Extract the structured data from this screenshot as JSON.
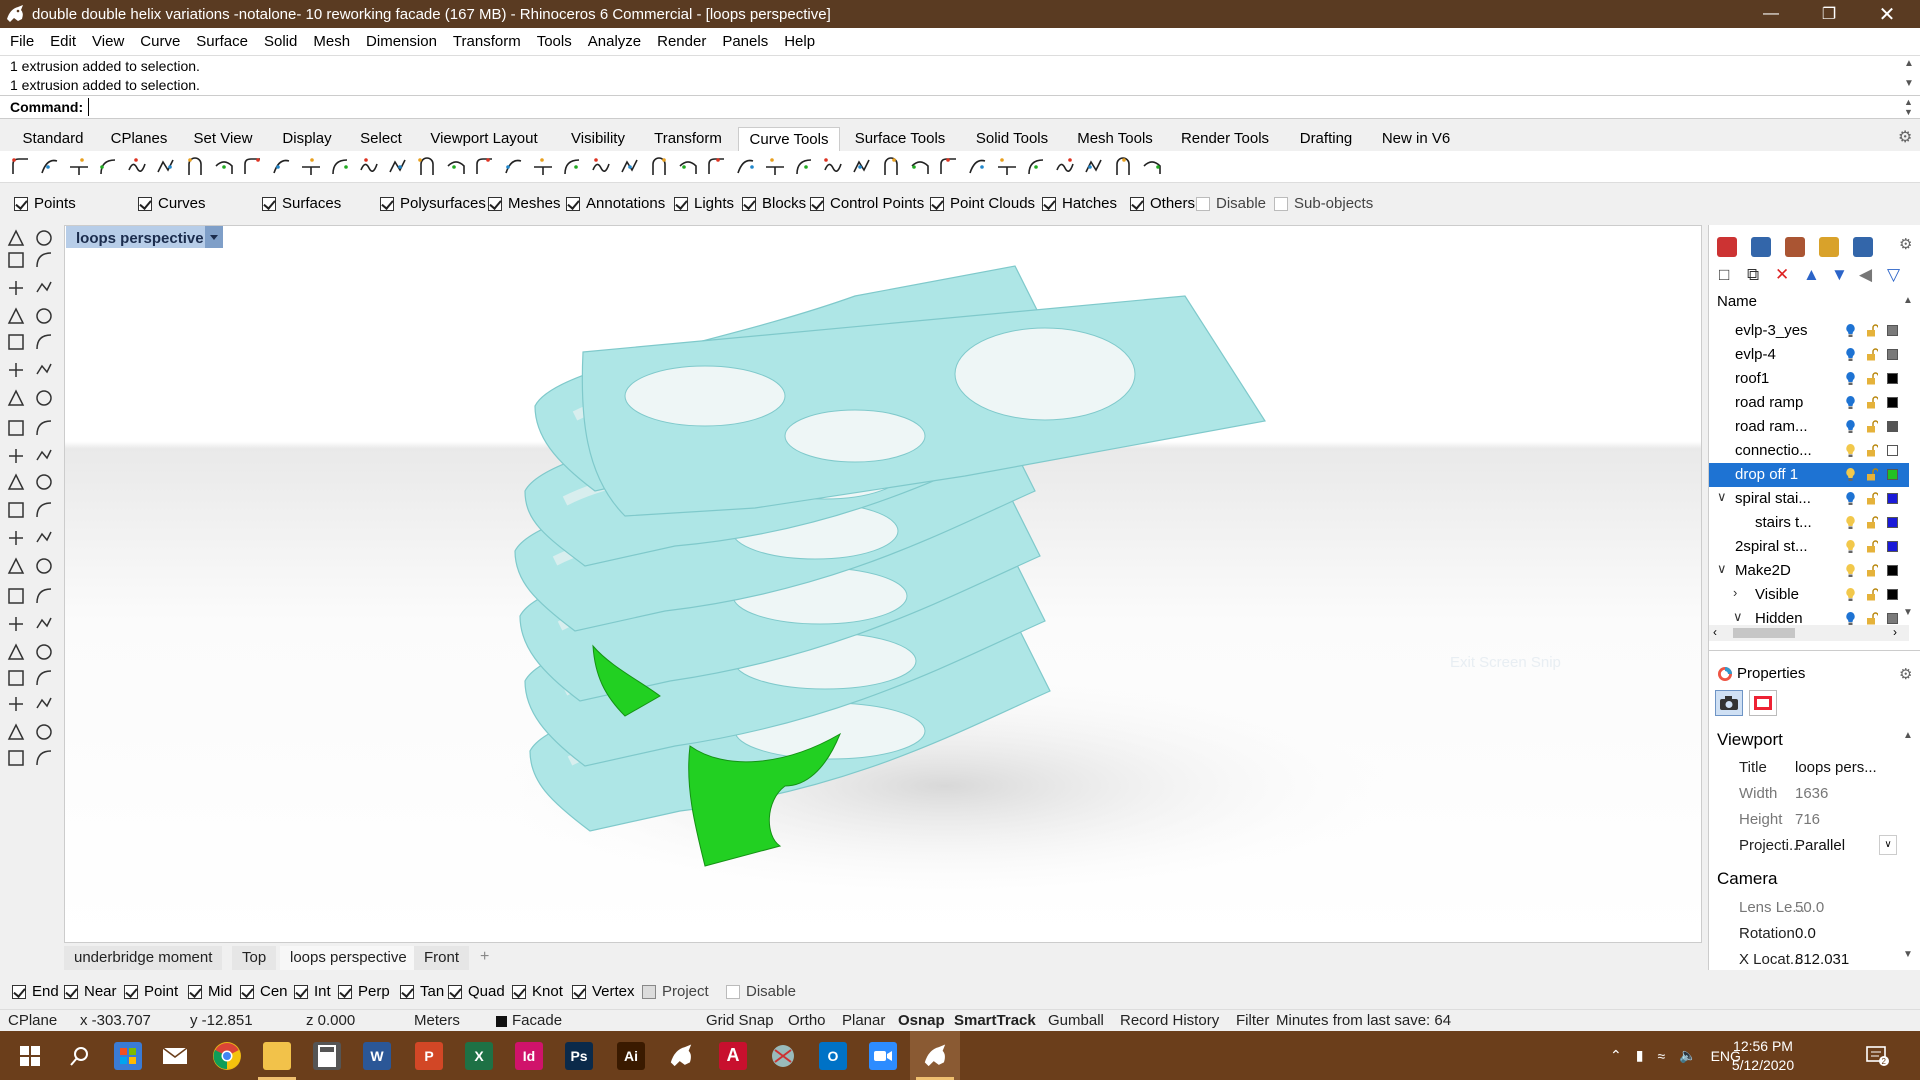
{
  "window": {
    "title": "double double helix variations -notalone- 10 reworking facade (167 MB) - Rhinoceros 6 Commercial - [loops perspective]",
    "controls": [
      "minimize",
      "restore",
      "close"
    ]
  },
  "menu": [
    "File",
    "Edit",
    "View",
    "Curve",
    "Surface",
    "Solid",
    "Mesh",
    "Dimension",
    "Transform",
    "Tools",
    "Analyze",
    "Render",
    "Panels",
    "Help"
  ],
  "command": {
    "history": [
      "1 extrusion added to selection.",
      "1 extrusion added to selection."
    ],
    "label": "Command:",
    "value": ""
  },
  "toolbar_tabs": [
    "Standard",
    "CPlanes",
    "Set View",
    "Display",
    "Select",
    "Viewport Layout",
    "Visibility",
    "Transform",
    "Curve Tools",
    "Surface Tools",
    "Solid Tools",
    "Mesh Tools",
    "Render Tools",
    "Drafting",
    "New in V6"
  ],
  "active_toolbar_tab": "Curve Tools",
  "selection_filter": [
    {
      "label": "Points",
      "checked": true
    },
    {
      "label": "Curves",
      "checked": true
    },
    {
      "label": "Surfaces",
      "checked": true
    },
    {
      "label": "Polysurfaces",
      "checked": true
    },
    {
      "label": "Meshes",
      "checked": true
    },
    {
      "label": "Annotations",
      "checked": true
    },
    {
      "label": "Lights",
      "checked": true
    },
    {
      "label": "Blocks",
      "checked": true
    },
    {
      "label": "Control Points",
      "checked": true
    },
    {
      "label": "Point Clouds",
      "checked": true
    },
    {
      "label": "Hatches",
      "checked": true
    },
    {
      "label": "Others",
      "checked": true
    },
    {
      "label": "Disable",
      "checked": false
    },
    {
      "label": "Sub-objects",
      "checked": false
    }
  ],
  "viewport": {
    "title": "loops perspective",
    "watermark": "Exit Screen Snip",
    "colors": {
      "model": "#aee6e6",
      "model_edge": "#7fc9cb",
      "highlight": "#22d022"
    }
  },
  "viewport_tabs": [
    "underbridge moment",
    "Top",
    "loops perspective",
    "Front"
  ],
  "active_viewport_tab": "loops perspective",
  "osnap": [
    {
      "label": "End",
      "checked": true
    },
    {
      "label": "Near",
      "checked": true
    },
    {
      "label": "Point",
      "checked": true
    },
    {
      "label": "Mid",
      "checked": true
    },
    {
      "label": "Cen",
      "checked": true
    },
    {
      "label": "Int",
      "checked": true
    },
    {
      "label": "Perp",
      "checked": true
    },
    {
      "label": "Tan",
      "checked": true
    },
    {
      "label": "Quad",
      "checked": true
    },
    {
      "label": "Knot",
      "checked": true
    },
    {
      "label": "Vertex",
      "checked": true
    },
    {
      "label": "Project",
      "checked": false
    },
    {
      "label": "Disable",
      "checked": false
    }
  ],
  "status": {
    "cplane": "CPlane",
    "x": "x -303.707",
    "y": "y -12.851",
    "z": "z 0.000",
    "units": "Meters",
    "layer": "Facade",
    "grid_snap": "Grid Snap",
    "ortho": "Ortho",
    "planar": "Planar",
    "osnap": "Osnap",
    "smarttrack": "SmartTrack",
    "gumball": "Gumball",
    "record_history": "Record History",
    "filter": "Filter",
    "minutes": "Minutes from last save: 64"
  },
  "layers": {
    "header": "Name",
    "items": [
      {
        "name": "evlp-3_yes",
        "indent": 1,
        "bulb": "#1e73d3",
        "swatch": "#7a7a7a"
      },
      {
        "name": "evlp-4",
        "indent": 1,
        "bulb": "#1e73d3",
        "swatch": "#7a7a7a"
      },
      {
        "name": "roof1",
        "indent": 1,
        "bulb": "#1e73d3",
        "swatch": "#000000"
      },
      {
        "name": "road ramp",
        "indent": 1,
        "bulb": "#1e73d3",
        "swatch": "#000000"
      },
      {
        "name": "road ram...",
        "indent": 1,
        "bulb": "#1e73d3",
        "swatch": "#555555"
      },
      {
        "name": "connectio...",
        "indent": 1,
        "bulb": "#f2c84b",
        "swatch": "#ffffff"
      },
      {
        "name": "drop off 1",
        "indent": 1,
        "bulb": "#f2c84b",
        "swatch": "#22c022",
        "selected": true
      },
      {
        "name": "spiral stai...",
        "indent": 1,
        "bulb": "#1e73d3",
        "swatch": "#1a1ad8",
        "expander": "v"
      },
      {
        "name": "stairs t...",
        "indent": 2,
        "bulb": "#f2c84b",
        "swatch": "#1a1ad8"
      },
      {
        "name": "2spiral st...",
        "indent": 1,
        "bulb": "#f2c84b",
        "swatch": "#1a1ad8"
      },
      {
        "name": "Make2D",
        "indent": 1,
        "bulb": "#f2c84b",
        "swatch": "#000000",
        "expander": "v"
      },
      {
        "name": "Visible",
        "indent": 2,
        "bulb": "#f2c84b",
        "swatch": "#000000",
        "expander": ">"
      },
      {
        "name": "Hidden",
        "indent": 2,
        "bulb": "#1e73d3",
        "swatch": "#7a7a7a",
        "expander": "v"
      }
    ]
  },
  "properties": {
    "title": "Properties",
    "viewport_section": "Viewport",
    "camera_section": "Camera",
    "rows": [
      {
        "key": "Title",
        "value": "loops pers...",
        "disabled": false
      },
      {
        "key": "Width",
        "value": "1636",
        "disabled": true
      },
      {
        "key": "Height",
        "value": "716",
        "disabled": true
      },
      {
        "key": "Projecti...",
        "value": "Parallel",
        "disabled": false
      }
    ],
    "camera_rows": [
      {
        "key": "Lens Le...",
        "value": "50.0",
        "disabled": true
      },
      {
        "key": "Rotation",
        "value": "0.0",
        "disabled": false
      },
      {
        "key": "X Locat...",
        "value": "812.031",
        "disabled": false
      }
    ]
  },
  "taskbar": {
    "apps": [
      {
        "name": "start",
        "label": ""
      },
      {
        "name": "search",
        "label": ""
      },
      {
        "name": "store",
        "label": ""
      },
      {
        "name": "mail",
        "label": ""
      },
      {
        "name": "chrome",
        "label": ""
      },
      {
        "name": "file-explorer",
        "label": ""
      },
      {
        "name": "calculator",
        "label": ""
      },
      {
        "name": "word",
        "label": "W"
      },
      {
        "name": "powerpoint",
        "label": "P"
      },
      {
        "name": "excel",
        "label": "X"
      },
      {
        "name": "indesign",
        "label": "Id"
      },
      {
        "name": "photoshop",
        "label": "Ps"
      },
      {
        "name": "illustrator",
        "label": "Ai"
      },
      {
        "name": "rhino5",
        "label": ""
      },
      {
        "name": "acrobat",
        "label": ""
      },
      {
        "name": "snipping",
        "label": ""
      },
      {
        "name": "outlook",
        "label": "O"
      },
      {
        "name": "zoom",
        "label": ""
      },
      {
        "name": "rhino6",
        "label": ""
      }
    ],
    "lang": "ENG",
    "time": "12:56 PM",
    "date": "5/12/2020"
  }
}
